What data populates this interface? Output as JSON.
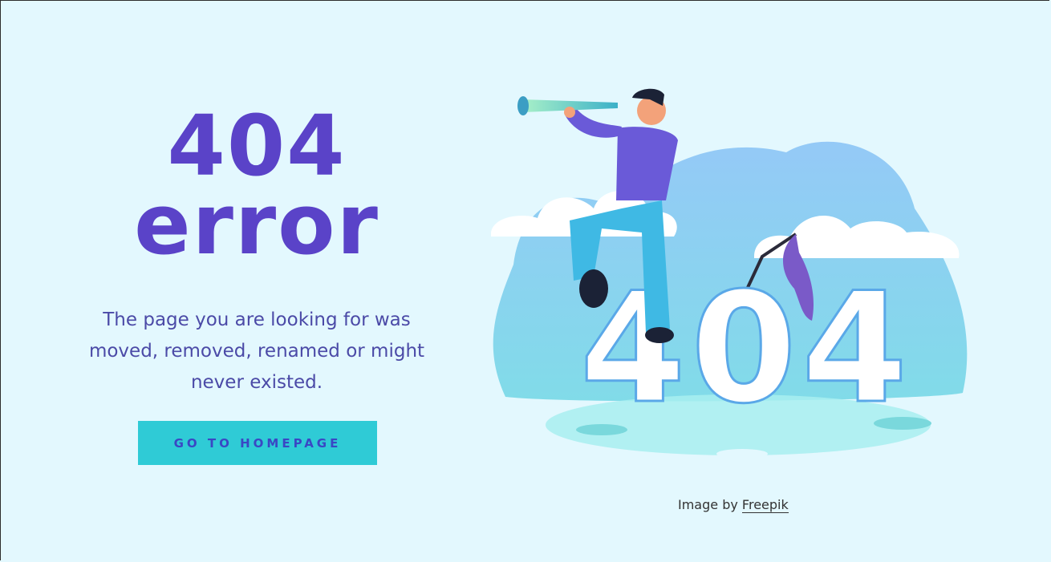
{
  "hero": {
    "line1": "404",
    "line2": "error",
    "description": "The page you are looking for was moved, removed, renamed or might never existed.",
    "button_label": "GO TO HOMEPAGE"
  },
  "illustration": {
    "big_text": "404"
  },
  "credit": {
    "prefix": "Image by",
    "link_label": "Freepik"
  },
  "colors": {
    "background": "#e3f8fe",
    "heading": "#5a43c8",
    "text": "#4b4aa7",
    "button": "#2fcbd6",
    "button_text": "#3a47c4"
  }
}
